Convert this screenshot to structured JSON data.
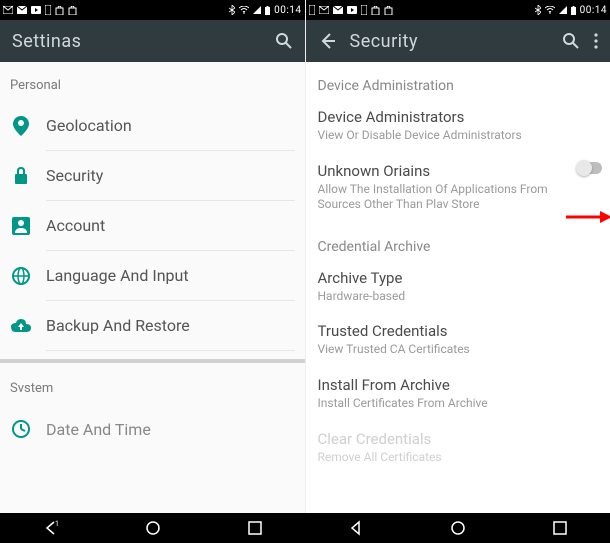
{
  "status": {
    "time": "00:14"
  },
  "left": {
    "app_title": "Settinas",
    "section_personal": "Personal",
    "section_system": "Svstem",
    "items": [
      {
        "label": "Geolocation"
      },
      {
        "label": "Security"
      },
      {
        "label": "Account"
      },
      {
        "label": "Language And Input"
      },
      {
        "label": "Backup And Restore"
      }
    ],
    "system_items": [
      {
        "label": "Date And Time"
      }
    ]
  },
  "right": {
    "app_title": "Security",
    "sections": {
      "device_admin": {
        "header": "Device Administration",
        "admins": {
          "title": "Device Administrators",
          "sub": "View Or Disable Device Administrators"
        },
        "unknown": {
          "title": "Unknown Oriains",
          "sub": "Allow The Installation Of Applications From Sources Other Than Plav Store"
        }
      },
      "cred_archive": {
        "header": "Credential Archive",
        "archive_type": {
          "title": "Archive Type",
          "sub": "Hardware-based"
        },
        "trusted": {
          "title": "Trusted Credentials",
          "sub": "View Trusted CA Certificates"
        },
        "install": {
          "title": "Install From Archive",
          "sub": "Install Certificates From Archive"
        },
        "clear": {
          "title": "Clear Credentials",
          "sub": "Remove All Certificates"
        }
      }
    }
  }
}
